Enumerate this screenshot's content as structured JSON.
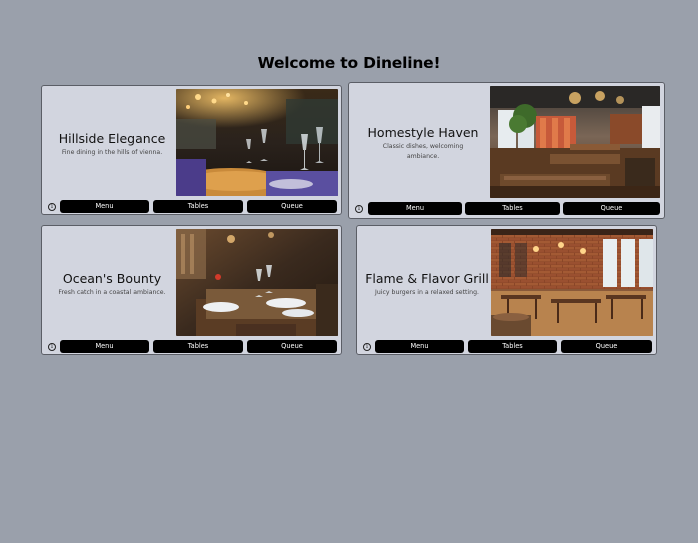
{
  "page": {
    "title": "Welcome to Dineline!"
  },
  "restaurants": [
    {
      "name": "Hillside Elegance",
      "description": "Fine dining in the hills of vienna.",
      "photo": "restaurant-interior-wine-glasses-photo",
      "buttons": {
        "menu": "Menu",
        "tables": "Tables",
        "queue": "Queue"
      }
    },
    {
      "name": "Homestyle Haven",
      "description": "Classic dishes, welcoming ambiance.",
      "photo": "bright-restaurant-dining-hall-photo",
      "buttons": {
        "menu": "Menu",
        "tables": "Tables",
        "queue": "Queue"
      }
    },
    {
      "name": "Ocean's Bounty",
      "description": "Fresh catch in a coastal ambiance.",
      "photo": "warm-lit-table-settings-photo",
      "buttons": {
        "menu": "Menu",
        "tables": "Tables",
        "queue": "Queue"
      }
    },
    {
      "name": "Flame & Flavor Grill",
      "description": "Juicy burgers in a relaxed setting.",
      "photo": "brick-wall-dining-room-photo",
      "buttons": {
        "menu": "Menu",
        "tables": "Tables",
        "queue": "Queue"
      }
    }
  ],
  "icons": {
    "info": "info-circle-icon"
  },
  "colors": {
    "background": "#9aa0ab",
    "card": "#d2d5df",
    "button": "#000000",
    "button_text": "#ffffff"
  }
}
